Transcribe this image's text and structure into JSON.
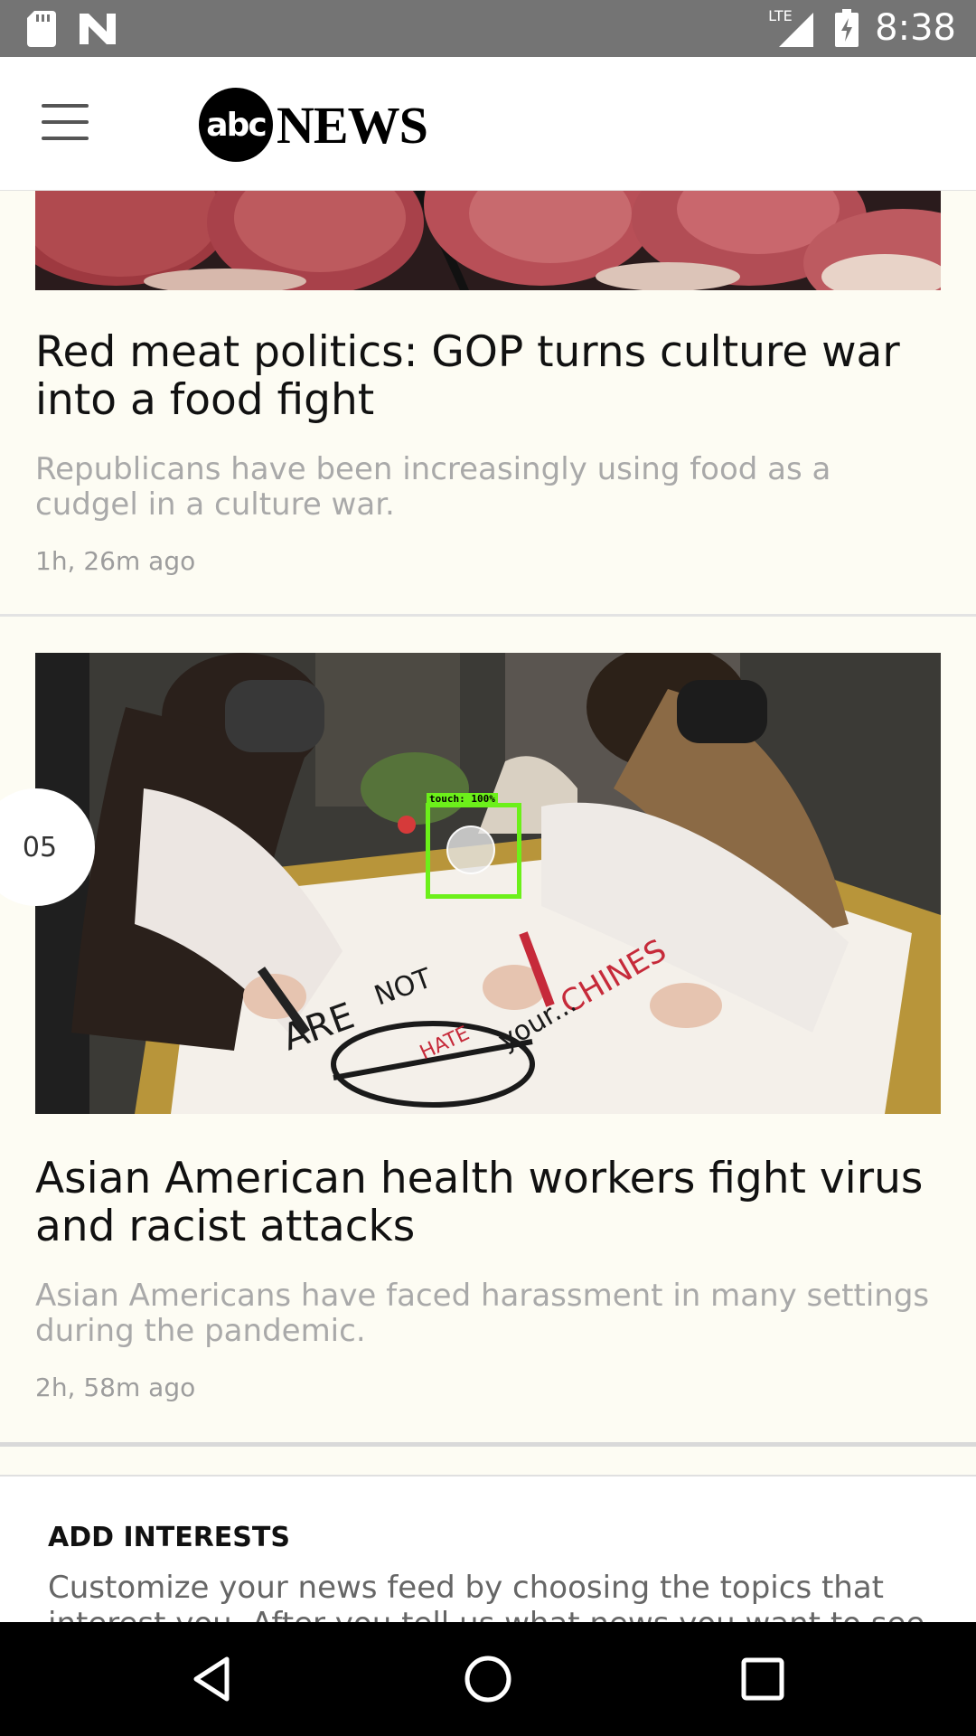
{
  "status_bar": {
    "time": "8:38",
    "network": "LTE",
    "left_icons": [
      "sd-card-icon",
      "n-notification-icon"
    ],
    "right_icons": [
      "signal-icon",
      "battery-charging-icon"
    ]
  },
  "app_bar": {
    "menu_icon": "hamburger-menu-icon",
    "logo_abc": "abc",
    "logo_news": "NEWS"
  },
  "feed": {
    "articles": [
      {
        "headline": "Red meat politics: GOP turns culture war into a food fight",
        "summary": "Republicans have been increasingly using food as a cudgel in a culture war.",
        "timestamp": "1h, 26m ago",
        "image": "raw-steaks-photo"
      },
      {
        "headline": "Asian American health workers fight virus and racist attacks",
        "summary": "Asian Americans have faced harassment in many settings during the pandemic.",
        "timestamp": "2h, 58m ago",
        "image": "health-workers-making-protest-sign-photo",
        "badge": "05"
      }
    ],
    "touch_overlay": {
      "label": "touch: 100%",
      "color": "#6cf01a"
    }
  },
  "add_interests": {
    "title": "ADD INTERESTS",
    "body": "Customize your news feed by choosing the topics that interest you. After you tell us what news you want to see"
  },
  "nav_bar": {
    "back": "back-icon",
    "home": "home-icon",
    "recents": "recents-icon"
  },
  "colors": {
    "status_bar": "#747474",
    "card_bg": "#fdfcf3",
    "summary_text": "#a9a9a9",
    "accent_touch": "#6cf01a"
  }
}
